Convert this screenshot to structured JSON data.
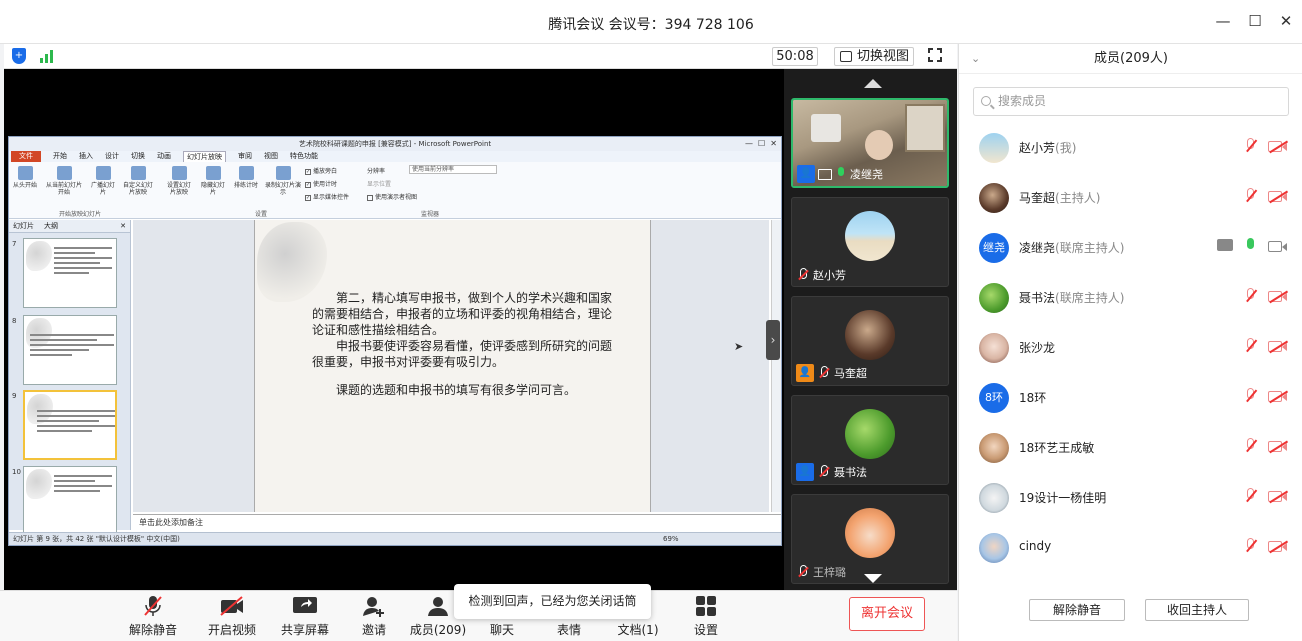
{
  "window": {
    "title": "腾讯会议 会议号：394 728 106"
  },
  "topstrip": {
    "timer": "50:08",
    "switch_view": "切换视图"
  },
  "ppt": {
    "title": "艺术院校科研课题的申报 [兼容模式] - Microsoft PowerPoint",
    "menu": [
      "文件",
      "开始",
      "插入",
      "设计",
      "切换",
      "动画",
      "幻灯片放映",
      "审阅",
      "视图",
      "特色功能"
    ],
    "ribbon_buttons": [
      "从头开始",
      "从当前幻灯片开始",
      "广播幻灯片",
      "自定义幻灯片放映",
      "设置幻灯片放映",
      "隐藏幻灯片",
      "排练计时",
      "录制幻灯片演示"
    ],
    "checks": [
      "播放旁白",
      "使用计时",
      "显示媒体控件"
    ],
    "res_label": "分辨率",
    "res_value": "使用当前分辨率",
    "show_on": "显示位置",
    "presenter": "使用演示者视图",
    "groups": [
      "开始放映幻灯片",
      "设置",
      "监视器"
    ],
    "panel_tabs": [
      "幻灯片",
      "大纲"
    ],
    "thumb_numbers": [
      "7",
      "8",
      "9",
      "10"
    ],
    "slide_text": [
      "第二，精心填写申报书，做到个人的学术兴趣和国家的需要相结合，申报者的立场和评委的视角相结合，理论论证和感性描绘相结合。",
      "申报书要使评委容易看懂，使评委感到所研究的问题很重要，申报书对评委要有吸引力。",
      "课题的选题和申报书的填写有很多学问可言。"
    ],
    "notes": "单击此处添加备注",
    "status": "幻灯片 第 9 张，共 42 张   \"默认设计模板\"   中文(中国)",
    "zoom": "69%"
  },
  "videos": [
    {
      "name": "凌继尧",
      "role": "host"
    },
    {
      "name": "赵小芳"
    },
    {
      "name": "马奎超",
      "role": "host"
    },
    {
      "name": "聂书法",
      "role": "cohost"
    },
    {
      "name": "王梓璐"
    }
  ],
  "tray": {
    "buttons": [
      "解除静音",
      "开启视频",
      "共享屏幕",
      "邀请",
      "成员(209)",
      "聊天",
      "表情",
      "文档(1)",
      "设置"
    ],
    "leave": "离开会议",
    "tooltip": "检测到回声，已经为您关闭话筒"
  },
  "members_panel": {
    "title": "成员(209人)",
    "search_placeholder": "搜索成员",
    "members": [
      {
        "name": "赵小芳",
        "role": "(我)",
        "status": "muted"
      },
      {
        "name": "马奎超",
        "role": "(主持人)",
        "status": "muted"
      },
      {
        "name": "凌继尧",
        "role": "(联席主持人)",
        "status": "active",
        "avatar_text": "继尧"
      },
      {
        "name": "聂书法",
        "role": "(联席主持人)",
        "status": "muted"
      },
      {
        "name": "张沙龙",
        "role": "",
        "status": "muted"
      },
      {
        "name": "18环",
        "role": "",
        "status": "muted",
        "avatar_text": "8环"
      },
      {
        "name": "18环艺王成敏",
        "role": "",
        "status": "muted"
      },
      {
        "name": "19设计一杨佳明",
        "role": "",
        "status": "muted"
      },
      {
        "name": "cindy",
        "role": "",
        "status": "muted"
      }
    ],
    "unmute_all": "解除静音",
    "reclaim_host": "收回主持人"
  },
  "colors": {
    "accent": "#1a6ce8",
    "danger": "#e33333",
    "active_border": "#2fb96b"
  }
}
